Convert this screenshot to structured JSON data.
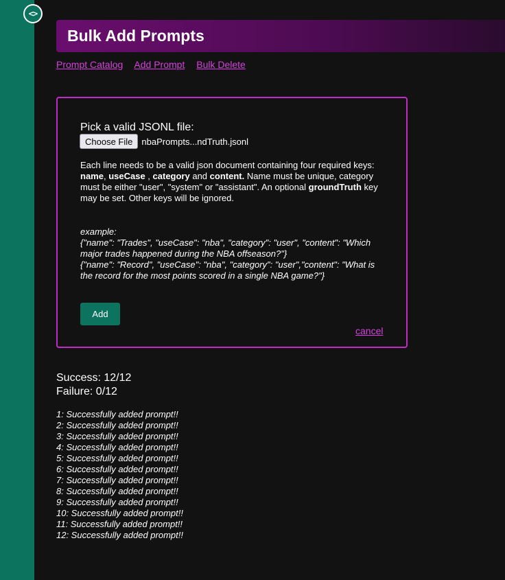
{
  "logo": {
    "glyph": "<>"
  },
  "header": {
    "title": "Bulk Add Prompts"
  },
  "nav": {
    "links": [
      {
        "label": "Prompt Catalog"
      },
      {
        "label": "Add Prompt"
      },
      {
        "label": "Bulk Delete"
      }
    ]
  },
  "form": {
    "pick_label": "Pick a valid JSONL file:",
    "choose_button": "Choose File",
    "file_name": "nbaPrompts...ndTruth.jsonl",
    "desc": {
      "p1": "Each line needs to be a valid json document containing four required keys: ",
      "k1": "name",
      "s1": ", ",
      "k2": "useCase",
      "s2": " , ",
      "k3": "category",
      "s3": " and ",
      "k4": "content.",
      "p2": " Name must be unique, category must be either \"user\", \"system\" or \"assistant\". An optional ",
      "k5": "groundTruth",
      "p3": " key may be set. Other keys will be ignored."
    },
    "example_label": "example:",
    "example_lines": [
      "{\"name\": \"Trades\", \"useCase\": \"nba\", \"category\": \"user\", \"content\": \"Which major trades happened during the NBA offseason?\"}",
      "{\"name\": \"Record\", \"useCase\": \"nba\", \"category\": \"user\",\"content\": \"What is the record for the most points scored in a single NBA game?\"}"
    ],
    "add_button": "Add",
    "cancel_link": "cancel"
  },
  "summary": {
    "success": "Success: 12/12",
    "failure": "Failure: 0/12"
  },
  "results": [
    "1: Successfully added prompt!!",
    "2: Successfully added prompt!!",
    "3: Successfully added prompt!!",
    "4: Successfully added prompt!!",
    "5: Successfully added prompt!!",
    "6: Successfully added prompt!!",
    "7: Successfully added prompt!!",
    "8: Successfully added prompt!!",
    "9: Successfully added prompt!!",
    "10: Successfully added prompt!!",
    "11: Successfully added prompt!!",
    "12: Successfully added prompt!!"
  ],
  "colors": {
    "sidebar": "#0b735e",
    "accent": "#d83ee0",
    "panel_border": "#c12bc6",
    "header_start": "#6a0e6e",
    "background": "#121212"
  }
}
